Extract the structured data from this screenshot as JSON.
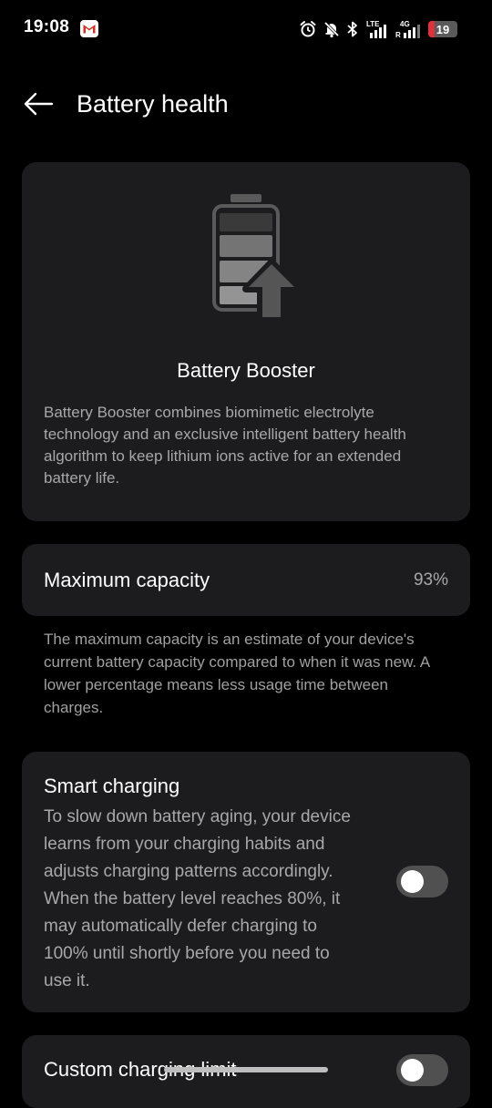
{
  "status_bar": {
    "time": "19:08",
    "network_4g": "4G",
    "roaming": "R",
    "lte": "LTE",
    "battery_level": "19",
    "icons": [
      "gmail-icon",
      "alarm-icon",
      "mute-bell-icon",
      "bluetooth-icon",
      "lte-signal-icon",
      "4g-signal-icon",
      "battery-icon"
    ],
    "battery_color": "#e0303a"
  },
  "header": {
    "title": "Battery health",
    "back_icon": "back-arrow-icon"
  },
  "booster": {
    "icon": "battery-booster-icon",
    "title": "Battery Booster",
    "description": "Battery Booster combines biomimetic electrolyte technology and an exclusive intelligent battery health algorithm to keep lithium ions active for an extended battery life."
  },
  "capacity": {
    "label": "Maximum capacity",
    "value": "93%",
    "note": "The maximum capacity is an estimate of your device's current battery capacity compared to when it was new. A lower percentage means less usage time between charges."
  },
  "smart_charging": {
    "title": "Smart charging",
    "description": "To slow down battery aging, your device learns from your charging habits and adjusts charging patterns accordingly. When the battery level reaches 80%, it may automatically defer charging to 100% until shortly before you need to use it.",
    "enabled": false
  },
  "custom_limit": {
    "title": "Custom charging limit",
    "enabled": false
  },
  "colors": {
    "background": "#000000",
    "card": "#1c1c1e",
    "secondary_text": "#a8a8a8",
    "toggle_off": "#505050"
  }
}
